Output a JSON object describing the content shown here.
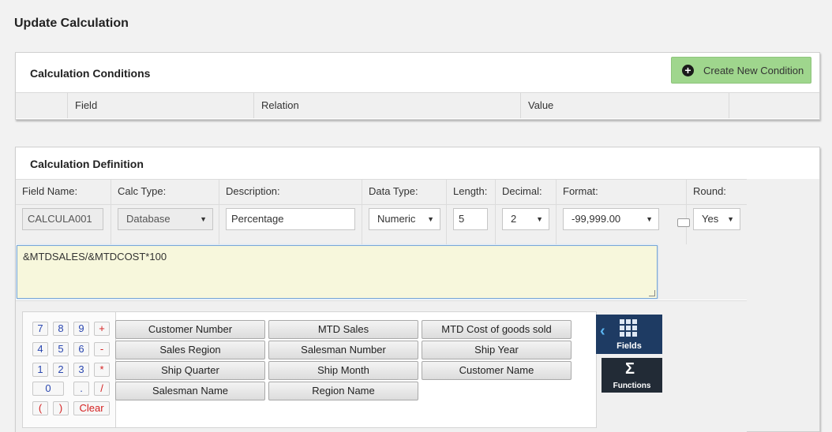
{
  "page": {
    "title": "Update Calculation"
  },
  "conditions": {
    "title": "Calculation Conditions",
    "create_label": "Create New Condition",
    "columns": [
      "Field",
      "Relation",
      "Value"
    ]
  },
  "definition": {
    "title": "Calculation Definition",
    "labels": {
      "field_name": "Field Name:",
      "calc_type": "Calc Type:",
      "description": "Description:",
      "data_type": "Data Type:",
      "length": "Length:",
      "decimal": "Decimal:",
      "format": "Format:",
      "round": "Round:"
    },
    "values": {
      "field_name": "CALCULA001",
      "calc_type": "Database",
      "description": "Percentage",
      "data_type": "Numeric",
      "length": "5",
      "decimal": "2",
      "format": "-99,999.00",
      "round": "Yes"
    },
    "formula": "&MTDSALES/&MTDCOST*100"
  },
  "keypad": {
    "keys": [
      "7",
      "8",
      "9",
      "+",
      "4",
      "5",
      "6",
      "-",
      "1",
      "2",
      "3",
      "*",
      "0",
      ".",
      "/",
      "(",
      ")",
      "Clear"
    ]
  },
  "fields": [
    "Customer Number",
    "MTD Sales",
    "MTD Cost of goods sold",
    "Sales Region",
    "Salesman Number",
    "Ship Year",
    "Ship Quarter",
    "Ship Month",
    "Customer Name",
    "Salesman Name",
    "Region Name"
  ],
  "side": {
    "fields_label": "Fields",
    "functions_label": "Functions"
  },
  "colors": {
    "accent_green": "#9fd68d",
    "formula_bg": "#f7f7dc",
    "fields_btn": "#1e3b63",
    "functions_btn": "#222b36"
  }
}
